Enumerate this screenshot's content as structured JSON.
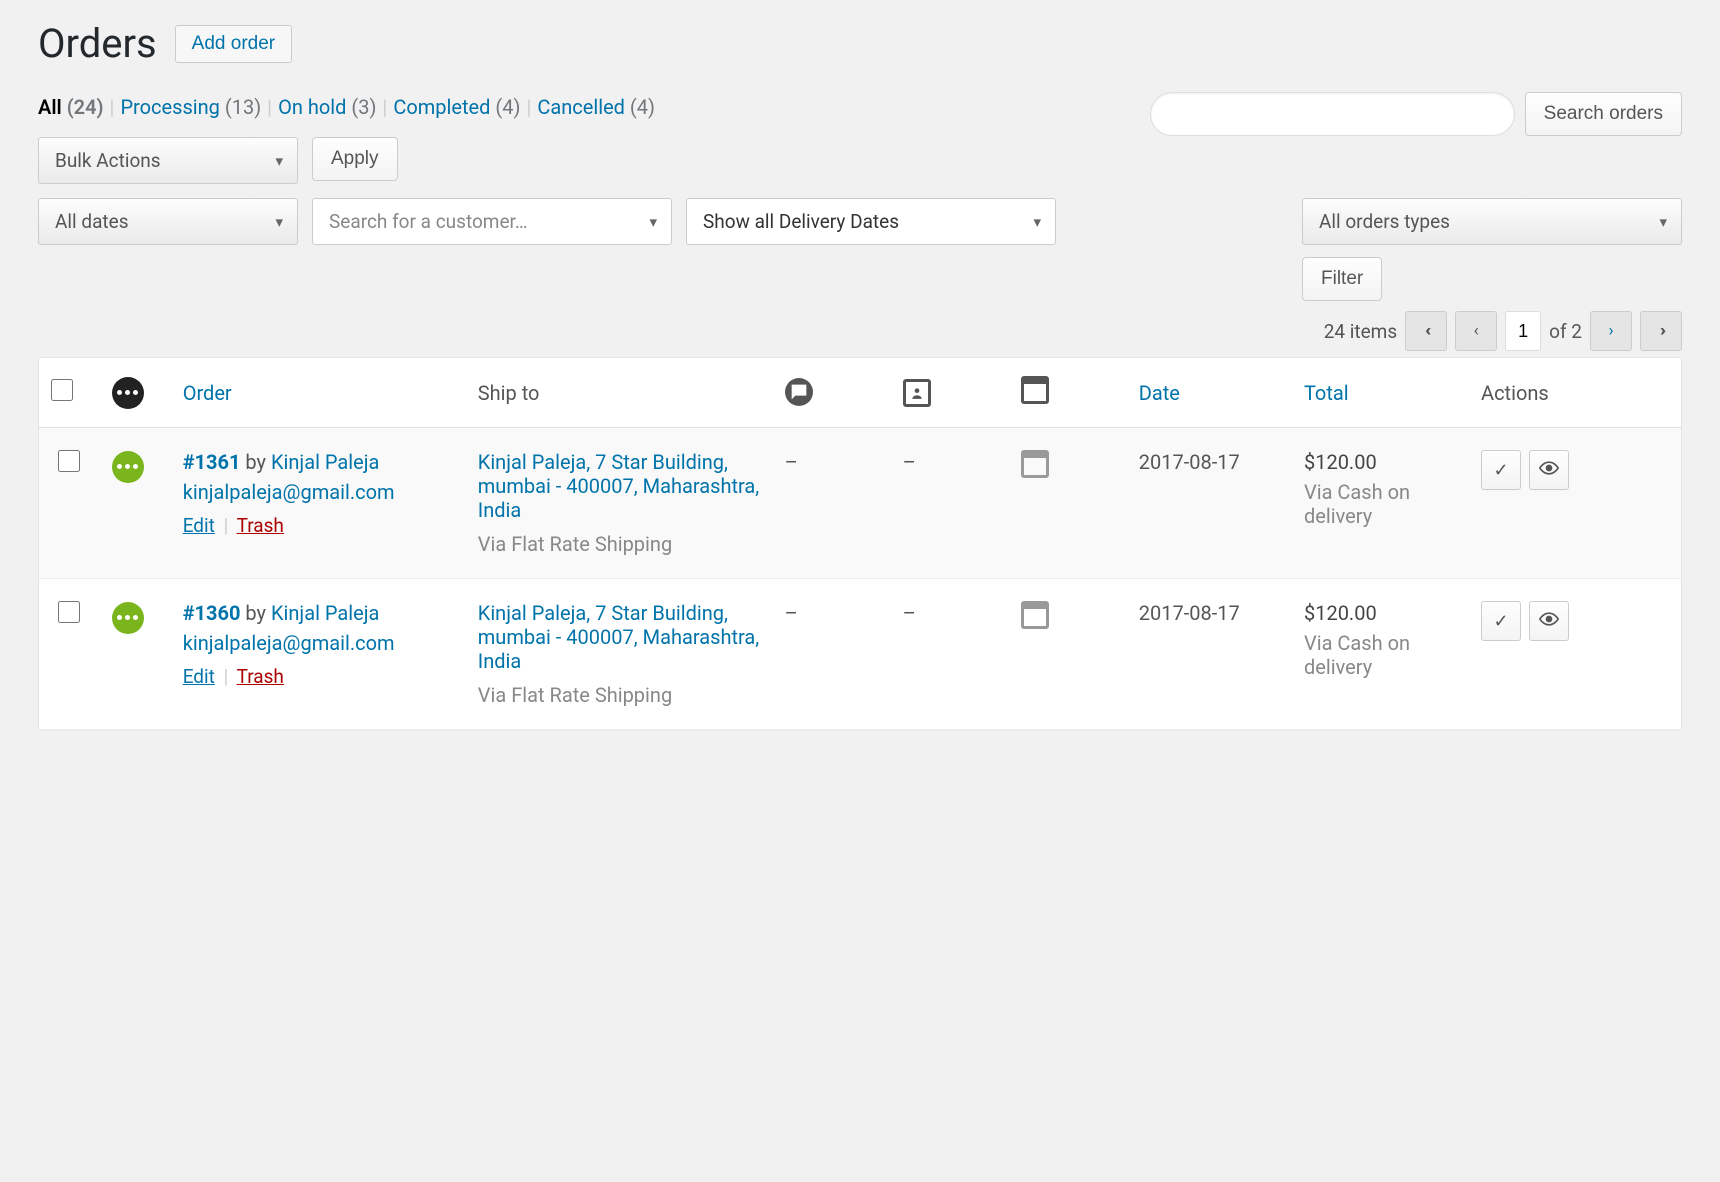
{
  "header": {
    "title": "Orders",
    "add_button": "Add order"
  },
  "status_filters": [
    {
      "label": "All",
      "count": "(24)",
      "current": true
    },
    {
      "label": "Processing",
      "count": "(13)",
      "current": false
    },
    {
      "label": "On hold",
      "count": "(3)",
      "current": false
    },
    {
      "label": "Completed",
      "count": "(4)",
      "current": false
    },
    {
      "label": "Cancelled",
      "count": "(4)",
      "current": false
    }
  ],
  "search": {
    "placeholder": "",
    "button": "Search orders"
  },
  "bulk": {
    "select": "Bulk Actions",
    "apply": "Apply"
  },
  "filters": {
    "dates": "All dates",
    "customer_placeholder": "Search for a customer…",
    "delivery": "Show all Delivery Dates",
    "order_types": "All orders types",
    "filter_btn": "Filter"
  },
  "pagination": {
    "items_label": "24 items",
    "current": "1",
    "of_label": "of 2"
  },
  "columns": {
    "order": "Order",
    "ship_to": "Ship to",
    "date": "Date",
    "total": "Total",
    "actions": "Actions"
  },
  "rows": [
    {
      "status": "processing",
      "order_num": "#1361",
      "by": "by",
      "customer": "Kinjal Paleja",
      "email": "kinjalpaleja@gmail.com",
      "edit": "Edit",
      "trash": "Trash",
      "ship_to": "Kinjal Paleja, 7 Star Building, mumbai - 400007, Maharashtra, India",
      "ship_via": "Via Flat Rate Shipping",
      "c1": "–",
      "c2": "–",
      "date": "2017-08-17",
      "total": "$120.00",
      "total_via": "Via Cash on delivery"
    },
    {
      "status": "processing",
      "order_num": "#1360",
      "by": "by",
      "customer": "Kinjal Paleja",
      "email": "kinjalpaleja@gmail.com",
      "edit": "Edit",
      "trash": "Trash",
      "ship_to": "Kinjal Paleja, 7 Star Building, mumbai - 400007, Maharashtra, India",
      "ship_via": "Via Flat Rate Shipping",
      "c1": "–",
      "c2": "–",
      "date": "2017-08-17",
      "total": "$120.00",
      "total_via": "Via Cash on delivery"
    }
  ]
}
